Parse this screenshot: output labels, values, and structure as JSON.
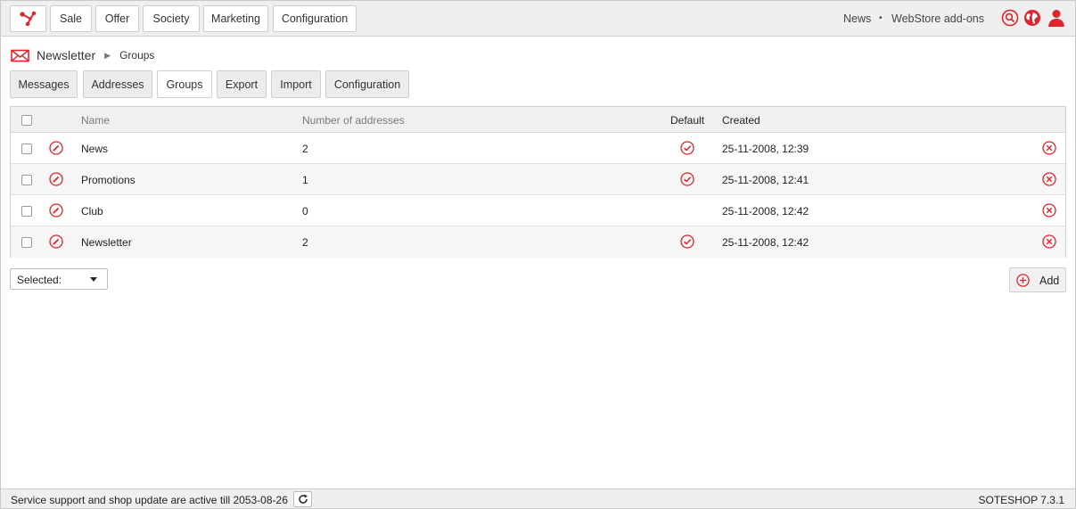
{
  "colors": {
    "accent": "#e0242c",
    "topbar_bg": "#efefef",
    "header_bg": "#f0f0f0"
  },
  "topbar": {
    "logo_icon": "soteshop-logo-icon",
    "menu": [
      "Sale",
      "Offer",
      "Society",
      "Marketing",
      "Configuration"
    ],
    "links": {
      "news": "News",
      "separator": "•",
      "addons": "WebStore add-ons"
    },
    "icons": [
      "search-icon",
      "globe-icon",
      "user-icon"
    ]
  },
  "breadcrumb": {
    "icon": "envelope-icon",
    "main": "Newsletter",
    "separator": "▶",
    "current": "Groups"
  },
  "tabs": [
    {
      "label": "Messages",
      "active": false
    },
    {
      "label": "Addresses",
      "active": false
    },
    {
      "label": "Groups",
      "active": true
    },
    {
      "label": "Export",
      "active": false
    },
    {
      "label": "Import",
      "active": false
    },
    {
      "label": "Configuration",
      "active": false
    }
  ],
  "table": {
    "headers": {
      "name": "Name",
      "count": "Number of addresses",
      "default": "Default",
      "created": "Created"
    },
    "rows": [
      {
        "name": "News",
        "count": "2",
        "default": true,
        "created": "25-11-2008, 12:39"
      },
      {
        "name": "Promotions",
        "count": "1",
        "default": true,
        "created": "25-11-2008, 12:41"
      },
      {
        "name": "Club",
        "count": "0",
        "default": false,
        "created": "25-11-2008, 12:42"
      },
      {
        "name": "Newsletter",
        "count": "2",
        "default": true,
        "created": "25-11-2008, 12:42"
      }
    ]
  },
  "bulk_select": {
    "label": "Selected:"
  },
  "add_button": {
    "label": "Add",
    "icon": "plus-circle-icon"
  },
  "statusbar": {
    "text": "Service support and shop update are active till 2053-08-26",
    "refresh_icon": "refresh-icon",
    "version": "SOTESHOP 7.3.1"
  }
}
